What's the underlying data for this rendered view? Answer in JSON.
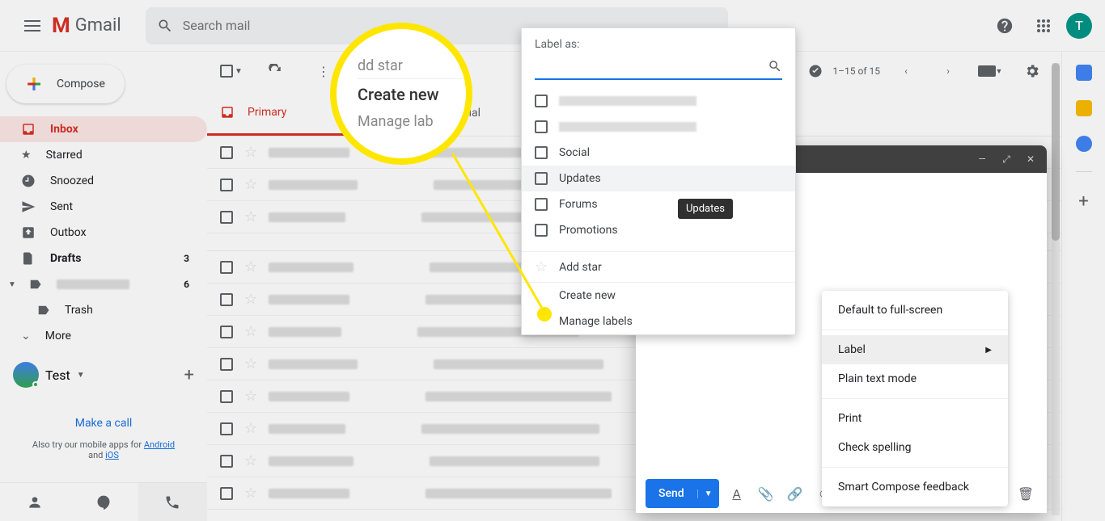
{
  "header": {
    "gmail": "Gmail",
    "search_placeholder": "Search mail",
    "avatar_letter": "T"
  },
  "sidebar": {
    "compose": "Compose",
    "items": [
      {
        "label": "Inbox",
        "icon": "inbox"
      },
      {
        "label": "Starred",
        "icon": "star"
      },
      {
        "label": "Snoozed",
        "icon": "clock"
      },
      {
        "label": "Sent",
        "icon": "send"
      },
      {
        "label": "Outbox",
        "icon": "outbox"
      },
      {
        "label": "Drafts",
        "icon": "file",
        "count": "3"
      },
      {
        "label": "",
        "icon": "label",
        "count": "6"
      },
      {
        "label": "Trash",
        "icon": "trash"
      },
      {
        "label": "More",
        "icon": "more"
      }
    ],
    "user": "Test",
    "make_call": "Make a call",
    "also_try_pre": "Also try our mobile apps for ",
    "android": "Android",
    "and": " and ",
    "ios": "iOS"
  },
  "toolbar": {
    "page_count": "1–15 of 15"
  },
  "tabs": {
    "primary": "Primary",
    "social": "Social"
  },
  "context_menu": {
    "full_screen": "Default to full-screen",
    "label": "Label",
    "plain": "Plain text mode",
    "print": "Print",
    "spell": "Check spelling",
    "smart": "Smart Compose feedback"
  },
  "label_popup": {
    "title": "Label as:",
    "social": "Social",
    "updates": "Updates",
    "forums": "Forums",
    "promotions": "Promotions",
    "add_star": "Add star",
    "create_new": "Create new",
    "manage": "Manage labels",
    "tooltip": "Updates"
  },
  "callout": {
    "add_star": "dd star",
    "create_new": "Create new",
    "manage": "Manage lab"
  },
  "compose_win": {
    "send": "Send"
  }
}
